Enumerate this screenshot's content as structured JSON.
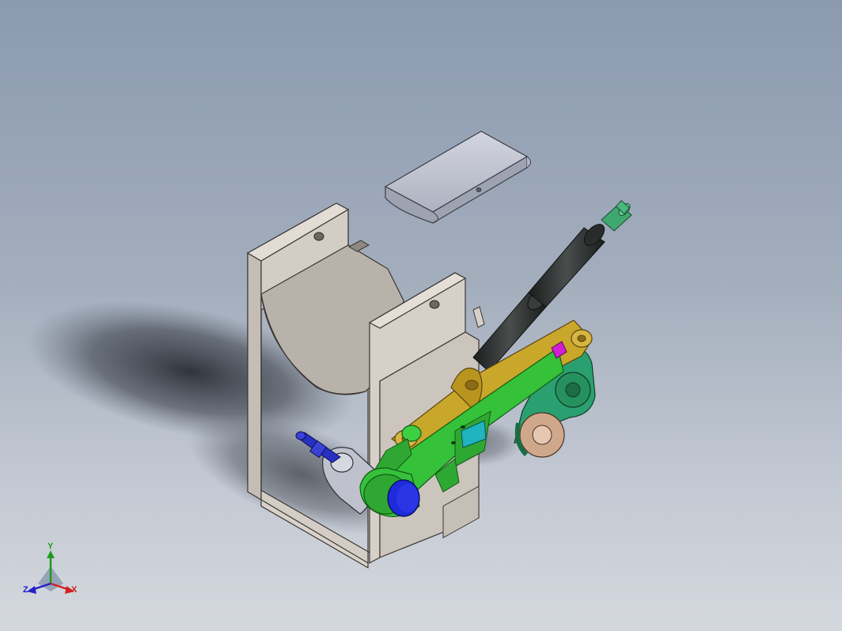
{
  "triad": {
    "x_label": "X",
    "y_label": "Y",
    "z_label": "Z",
    "x_color": "#d42020",
    "y_color": "#1f9a1f",
    "z_color": "#2020c8"
  },
  "colors": {
    "background_top": "#8b9ab0",
    "background_bottom": "#d4d8de",
    "housing": "#cfc8c0",
    "lid": "#c6cad6",
    "cylinder": "#2d2f2f",
    "rod_tip": "#3fa870",
    "yellow_arm": "#c9a72a",
    "green_arm": "#35c13a",
    "teal_link": "#2aa070",
    "disc": "#d8b49a",
    "blue_pin": "#1f2ad8",
    "magenta_pin": "#d020d0",
    "cyan_block": "#20b4c0"
  }
}
